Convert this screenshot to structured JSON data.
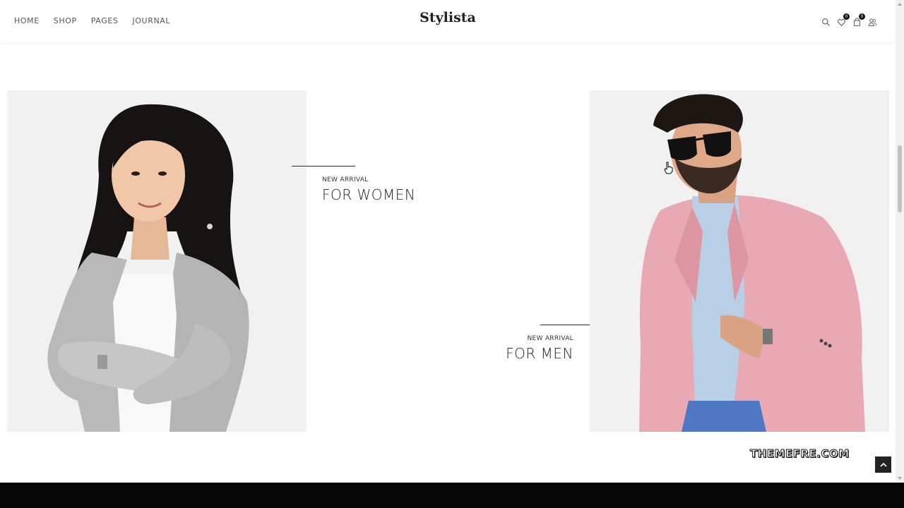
{
  "header": {
    "nav": [
      "HOME",
      "SHOP",
      "PAGES",
      "JOURNAL"
    ],
    "logo": "Stylista",
    "icons": [
      "search-icon",
      "wishlist-icon",
      "cart-icon",
      "account-icon"
    ],
    "wishlist_count": "0",
    "cart_count": "0"
  },
  "banners": {
    "women": {
      "tag": "NEW ARRIVAL",
      "title": "FOR WOMEN"
    },
    "men": {
      "tag": "NEW ARRIVAL",
      "title": "FOR MEN"
    }
  },
  "watermark": "THEMEFRE.COM",
  "colors": {
    "panel_bg": "#f1f1f1",
    "cardigan": "#b9b9b9",
    "blazer": "#e8a9b4",
    "footer": "#050505"
  }
}
